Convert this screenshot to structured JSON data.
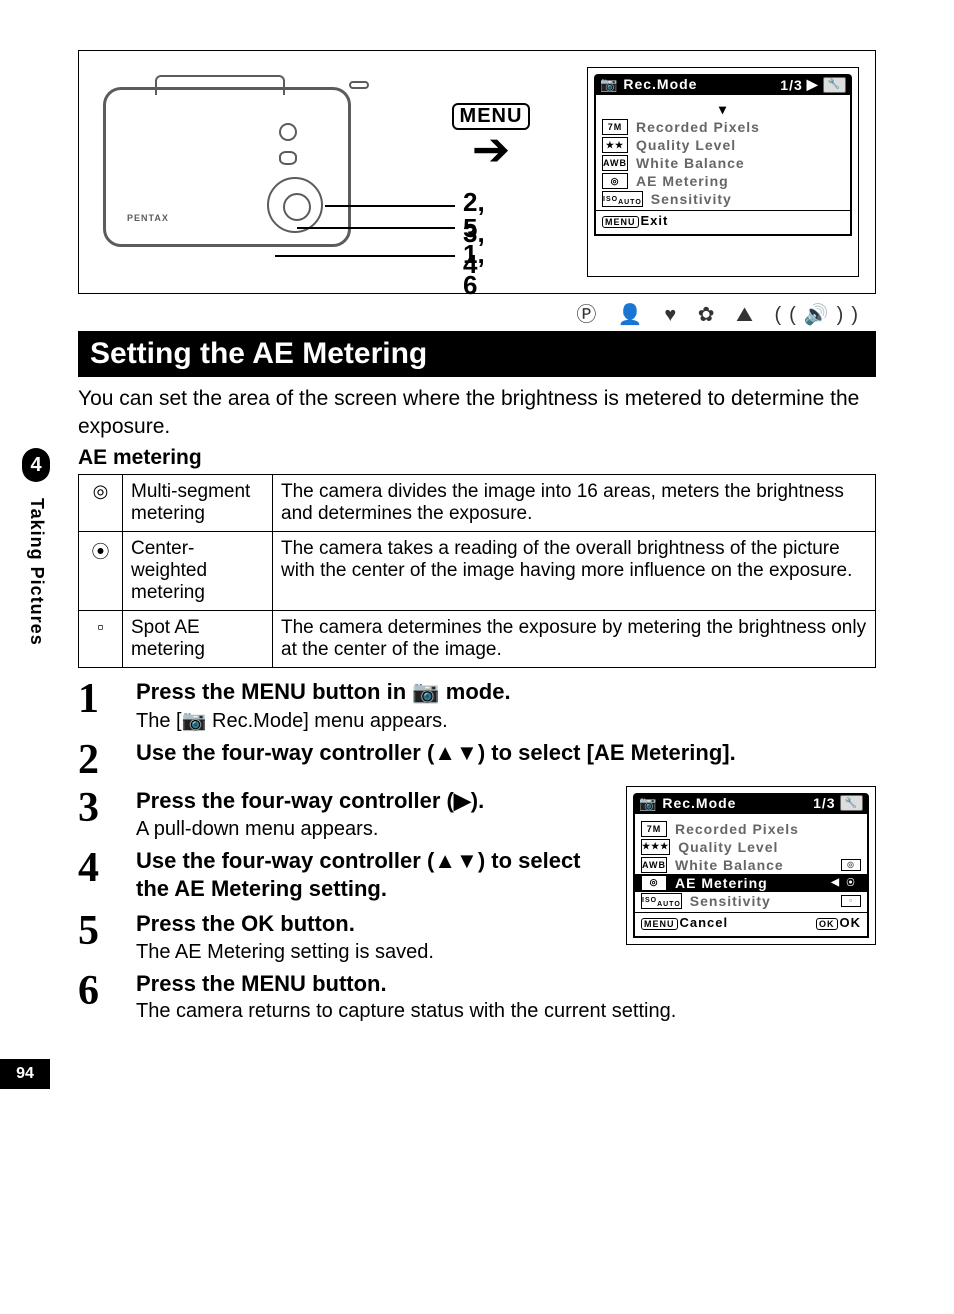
{
  "side": {
    "chapter_number": "4",
    "chapter_title": "Taking Pictures",
    "page_number": "94"
  },
  "diagram": {
    "brand": "PENTAX",
    "menu_label": "MENU",
    "callouts": {
      "a": "2, 3, 4",
      "b": "5",
      "c": "1, 6"
    }
  },
  "lcd_top": {
    "title": "Rec.Mode",
    "page_indicator": "1/3",
    "items": [
      {
        "icon": "7M",
        "label": "Recorded Pixels"
      },
      {
        "icon": "★★",
        "label": "Quality Level"
      },
      {
        "icon": "AWB",
        "label": "White Balance"
      },
      {
        "icon": "◎",
        "label": "AE Metering"
      },
      {
        "icon": "ISO",
        "label": "Sensitivity"
      }
    ],
    "footer_left_badge": "MENU",
    "footer_left": "Exit"
  },
  "mode_strip": "Ⓟ 👤 ♥ ✿ ⛰ ((🔊))",
  "heading": "Setting the AE Metering",
  "intro": "You can set the area of the screen where the brightness is metered to determine the exposure.",
  "subhead": "AE metering",
  "table": [
    {
      "icon": "◎",
      "name": "Multi-segment metering",
      "desc": "The camera divides the image into 16 areas, meters the brightness and determines the exposure."
    },
    {
      "icon": "⦿",
      "name": "Center-weighted metering",
      "desc": "The camera takes a reading of the overall brightness of the picture with the center of the image having more influence on the exposure."
    },
    {
      "icon": "▫",
      "name": "Spot AE metering",
      "desc": "The camera determines the exposure by metering the brightness only at the center of the image."
    }
  ],
  "steps": [
    {
      "n": "1",
      "title_pre": "Press the ",
      "title_badge": "MENU",
      "title_mid": " button in ",
      "title_icon": "📷",
      "title_post": " mode.",
      "desc_pre": "The [",
      "desc_icon": "📷",
      "desc_post": " Rec.Mode] menu appears."
    },
    {
      "n": "2",
      "title": "Use the four-way controller (▲▼) to select [AE Metering]."
    },
    {
      "n": "3",
      "title": "Press the four-way controller (▶).",
      "desc": "A pull-down menu appears."
    },
    {
      "n": "4",
      "title": "Use the four-way controller (▲▼) to select the AE Metering setting."
    },
    {
      "n": "5",
      "title_pre": "Press the ",
      "title_bold": "OK",
      "title_post": " button.",
      "desc": "The AE Metering setting is saved."
    },
    {
      "n": "6",
      "title_pre": "Press the ",
      "title_badge": "MENU",
      "title_post": " button.",
      "desc": "The camera returns to capture status with the current setting."
    }
  ],
  "lcd_bottom": {
    "title": "Rec.Mode",
    "page_indicator": "1/3",
    "items": [
      {
        "icon": "7M",
        "label": "Recorded Pixels"
      },
      {
        "icon": "★★★",
        "label": "Quality Level"
      },
      {
        "icon": "AWB",
        "label": "White Balance"
      },
      {
        "icon": "◎",
        "label": "AE Metering",
        "highlight": true
      },
      {
        "icon": "ISO",
        "label": "Sensitivity"
      }
    ],
    "options": [
      "◎",
      "⦿",
      "▫"
    ],
    "footer_left_badge": "MENU",
    "footer_left": "Cancel",
    "footer_right_badge": "OK",
    "footer_right": "OK"
  }
}
